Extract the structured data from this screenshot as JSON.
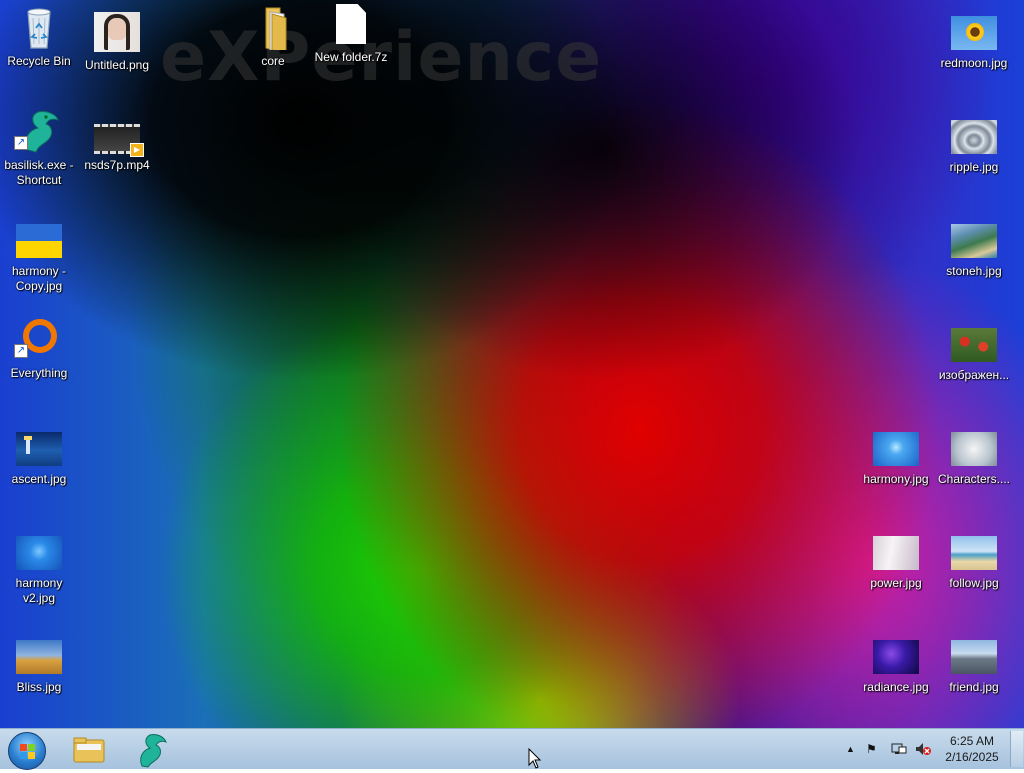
{
  "desktop": {
    "watermark": "eXPerience",
    "icons": {
      "recycle_bin": "Recycle Bin",
      "untitled_png": "Untitled.png",
      "core": "core",
      "new_folder_7z": "New folder.7z",
      "redmoon": "redmoon.jpg",
      "basilisk": "basilisk.exe - Shortcut",
      "nsds7p": "nsds7p.mp4",
      "ripple": "ripple.jpg",
      "harmony_copy": "harmony - Copy.jpg",
      "stoneh": "stoneh.jpg",
      "everything": "Everything",
      "izobrazhen": "изображен...",
      "ascent": "ascent.jpg",
      "harmony": "harmony.jpg",
      "characters": "Characters....",
      "harmony_v2": "harmony v2.jpg",
      "power": "power.jpg",
      "follow": "follow.jpg",
      "bliss": "Bliss.jpg",
      "radiance": "radiance.jpg",
      "friend": "friend.jpg"
    }
  },
  "taskbar": {
    "pinned": [
      "file-explorer-icon",
      "basilisk-icon"
    ],
    "tray": [
      "show-hidden-icons-icon",
      "action-center-flag-icon",
      "network-icon",
      "volume-muted-icon"
    ],
    "clock": {
      "time": "6:25 AM",
      "date": "2/16/2025"
    }
  }
}
